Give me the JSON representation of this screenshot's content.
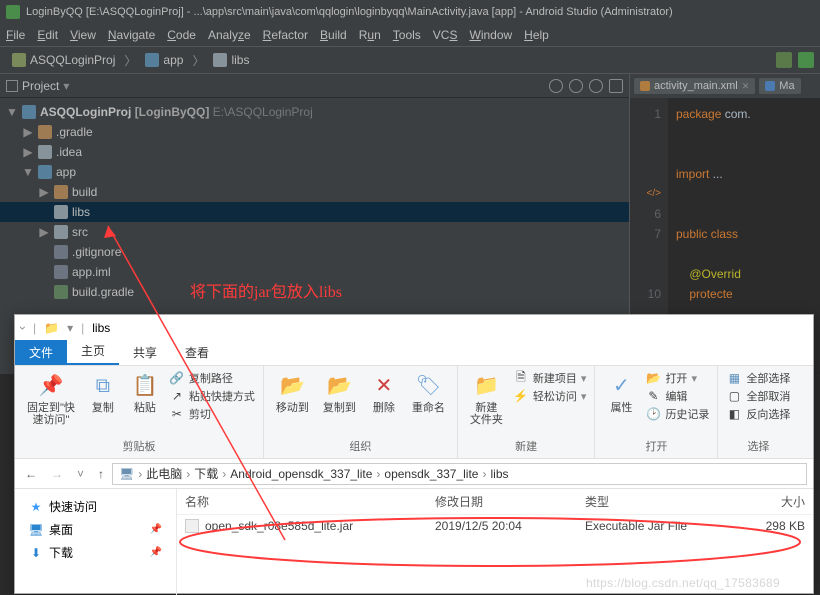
{
  "title": "LoginByQQ [E:\\ASQQLoginProj] - ...\\app\\src\\main\\java\\com\\qqlogin\\loginbyqq\\MainActivity.java [app] - Android Studio (Administrator)",
  "menus": [
    "File",
    "Edit",
    "View",
    "Navigate",
    "Code",
    "Analyze",
    "Refactor",
    "Build",
    "Run",
    "Tools",
    "VCS",
    "Window",
    "Help"
  ],
  "nav": {
    "crumb1": "ASQQLoginProj",
    "crumb2": "app",
    "crumb3": "libs"
  },
  "pane": {
    "label": "Project",
    "arrow": "▾"
  },
  "tree": {
    "proj_name": "ASQQLoginProj",
    "proj_meta_label": "[LoginByQQ]",
    "proj_path": "E:\\ASQQLoginProj",
    "gradle": ".gradle",
    "idea": ".idea",
    "app": "app",
    "build": "build",
    "libs": "libs",
    "src": "src",
    "gitignore": ".gitignore",
    "appiml": "app.iml",
    "buildgradle": "build.gradle"
  },
  "editor": {
    "tab1": "activity_main.xml",
    "tab2": "Ma",
    "gutter": [
      "1",
      "",
      "",
      "",
      "+",
      "6",
      "7",
      "",
      "",
      "10"
    ],
    "line1_kw": "package",
    "line1_pkg": " com.",
    "line2_kw": "import",
    "line2_rest": " ...",
    "line3_kw": "public class",
    "line4_ann": "@Overrid",
    "line5_kw": "protecte"
  },
  "annotation": "将下面的jar包放入libs",
  "explorer": {
    "title_folder": "libs",
    "tabs": {
      "file": "文件",
      "home": "主页",
      "share": "共享",
      "view": "查看"
    },
    "ribbon": {
      "g1": {
        "pin": "固定到\"快\n速访问\"",
        "copy": "复制",
        "paste": "粘贴",
        "copypath": "复制路径",
        "pasteshort": "粘贴快捷方式",
        "cut": "剪切",
        "label": "剪贴板"
      },
      "g2": {
        "moveto": "移动到",
        "copyto": "复制到",
        "delete": "删除",
        "rename": "重命名",
        "label": "组织"
      },
      "g3": {
        "newfolder": "新建\n文件夹",
        "newitem": "新建项目",
        "easy": "轻松访问",
        "label": "新建"
      },
      "g4": {
        "props": "属性",
        "open": "打开",
        "edit": "编辑",
        "history": "历史记录",
        "label": "打开"
      },
      "g5": {
        "selall": "全部选择",
        "selnone": "全部取消",
        "selinv": "反向选择",
        "label": "选择"
      }
    },
    "path": {
      "pc": "此电脑",
      "p1": "下载",
      "p2": "Android_opensdk_337_lite",
      "p3": "opensdk_337_lite",
      "p4": "libs"
    },
    "cols": {
      "name": "名称",
      "date": "修改日期",
      "type": "类型",
      "size": "大小"
    },
    "side": {
      "quick": "快速访问",
      "desktop": "桌面",
      "downloads": "下载"
    },
    "row": {
      "name": "open_sdk_r08e585d_lite.jar",
      "date": "2019/12/5 20:04",
      "type": "Executable Jar File",
      "size": "298 KB"
    }
  },
  "watermark": "https://blog.csdn.net/qq_17583689"
}
